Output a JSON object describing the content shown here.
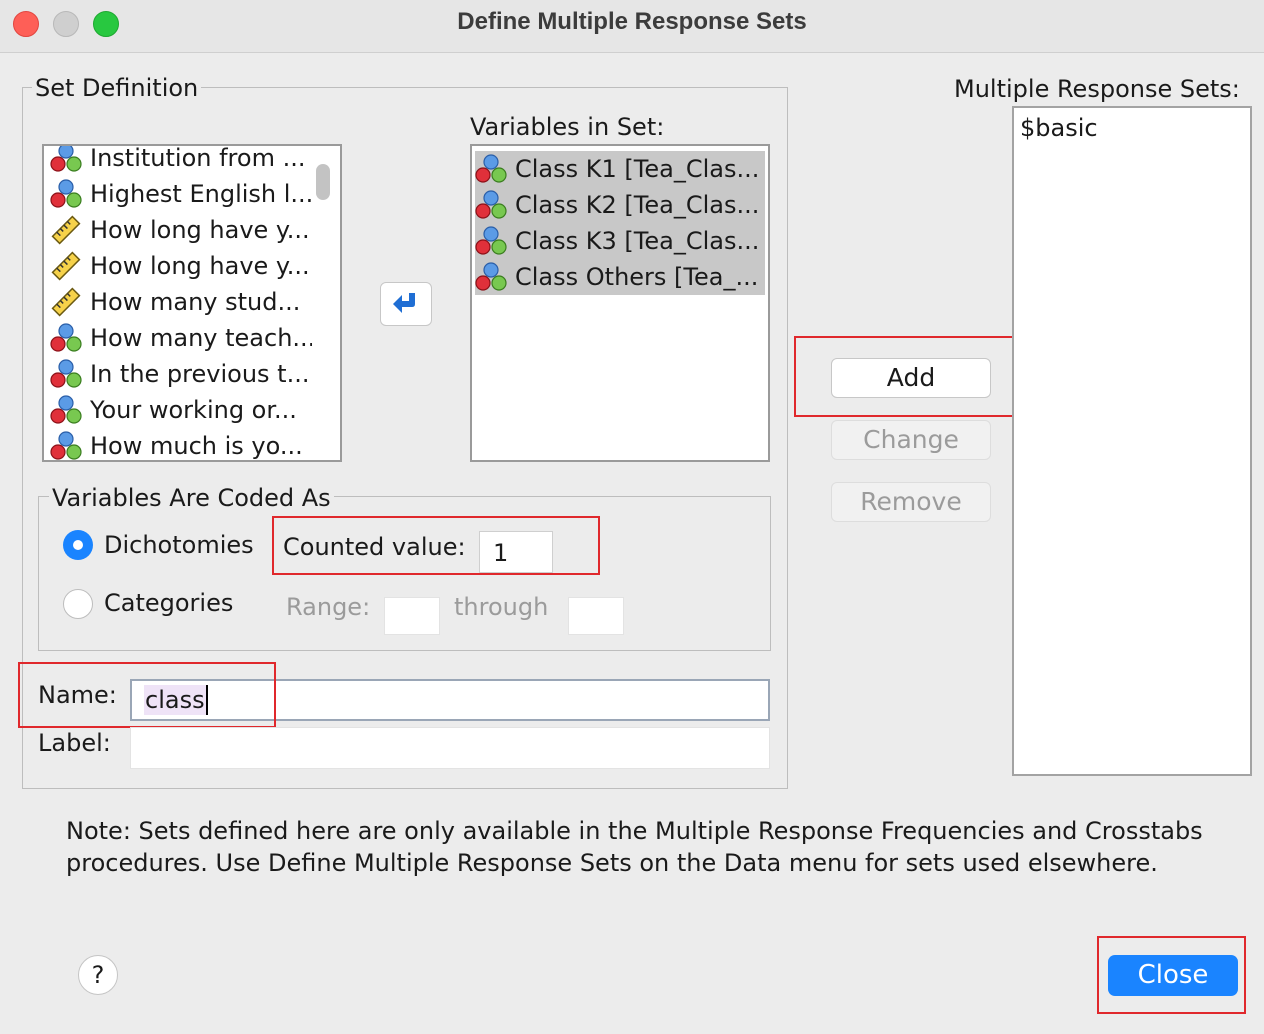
{
  "window": {
    "title": "Define Multiple Response Sets"
  },
  "set_definition": {
    "legend": "Set Definition",
    "source_variables": [
      {
        "label": "Institution from ...",
        "icon": "nominal-icon"
      },
      {
        "label": "Highest English l...",
        "icon": "nominal-icon"
      },
      {
        "label": "How long have y...",
        "icon": "scale-icon"
      },
      {
        "label": "How long have y...",
        "icon": "scale-icon"
      },
      {
        "label": "How many stud...",
        "icon": "scale-icon"
      },
      {
        "label": "How many teach...",
        "icon": "nominal-icon"
      },
      {
        "label": "In the previous t...",
        "icon": "nominal-icon"
      },
      {
        "label": "Your working or...",
        "icon": "nominal-icon"
      },
      {
        "label": "How much is yo...",
        "icon": "nominal-icon"
      }
    ],
    "variables_in_set_label": "Variables in Set:",
    "variables_in_set": [
      {
        "label": "Class K1 [Tea_Clas...",
        "icon": "nominal-icon"
      },
      {
        "label": "Class K2 [Tea_Clas...",
        "icon": "nominal-icon"
      },
      {
        "label": "Class K3 [Tea_Clas...",
        "icon": "nominal-icon"
      },
      {
        "label": "Class Others [Tea_...",
        "icon": "nominal-icon"
      }
    ],
    "coded_as": {
      "legend": "Variables Are Coded As",
      "dichotomies_label": "Dichotomies",
      "dichotomies_selected": true,
      "counted_value_label": "Counted value:",
      "counted_value": "1",
      "categories_label": "Categories",
      "range_label": "Range:",
      "through_label": "through"
    },
    "name_label": "Name:",
    "name_value": "class",
    "label_label": "Label:",
    "label_value": ""
  },
  "buttons": {
    "add": "Add",
    "change": "Change",
    "remove": "Remove",
    "close": "Close",
    "help": "?"
  },
  "response_sets": {
    "label": "Multiple Response Sets:",
    "items": [
      "$basic"
    ]
  },
  "note": "Note: Sets defined here are only available in the Multiple Response Frequencies and Crosstabs procedures. Use Define Multiple Response Sets on the Data menu for sets used elsewhere.",
  "colors": {
    "accent": "#1a84ff",
    "highlight": "#e0282c",
    "selection": "#c8c8c8"
  }
}
